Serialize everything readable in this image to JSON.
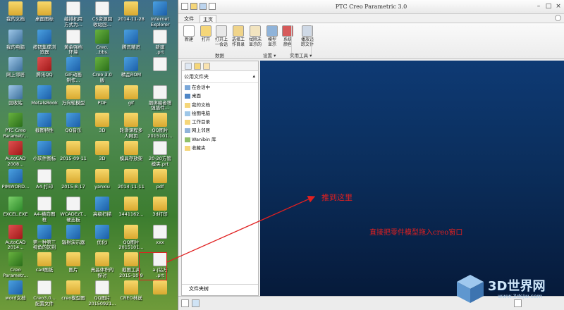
{
  "desktop": {
    "icons": [
      {
        "label": "我的文档",
        "icon": "folder-icon"
      },
      {
        "label": "桌面图标",
        "icon": "folder-icon"
      },
      {
        "label": "编排机用\n方式为...",
        "icon": "document-icon"
      },
      {
        "label": "CS资源回\n收站回...",
        "icon": "document-icon"
      },
      {
        "label": "2014-11-28",
        "icon": "folder-icon"
      },
      {
        "label": "Internet\nExplorer",
        "icon": "ie-icon"
      },
      {
        "label": "我的电脑",
        "icon": "computer-icon"
      },
      {
        "label": "按钮集成浏\n览器",
        "icon": "app-icon"
      },
      {
        "label": "黄金强档\n环境\n2...",
        "icon": "document-icon"
      },
      {
        "label": "Creo.\n..bbs.",
        "icon": "creo-icon"
      },
      {
        "label": "腾讯精灵",
        "icon": "app-icon"
      },
      {
        "label": "新建\n.prt",
        "icon": "document-icon"
      },
      {
        "label": "网上邻居",
        "icon": "network-icon"
      },
      {
        "label": "腾讯QQ",
        "icon": "qq-icon"
      },
      {
        "label": "GIF动画\n制作...",
        "icon": "app-icon"
      },
      {
        "label": "Creo 3.0\n版",
        "icon": "creo-icon"
      },
      {
        "label": "精品ROM",
        "icon": "app-icon"
      },
      {
        "label": "",
        "icon": "document-icon"
      },
      {
        "label": "回收站",
        "icon": "recycle-icon"
      },
      {
        "label": "MetalsBook",
        "icon": "app-icon"
      },
      {
        "label": "万向轮模型",
        "icon": "folder-icon"
      },
      {
        "label": "PDF",
        "icon": "folder-icon"
      },
      {
        "label": "gif",
        "icon": "folder-icon"
      },
      {
        "label": "捆绑编者增\n强插件...",
        "icon": "document-icon"
      },
      {
        "label": "PTC Creo\nParametr...",
        "icon": "creo-icon"
      },
      {
        "label": "截图特性",
        "icon": "app-icon"
      },
      {
        "label": "QQ音乐",
        "icon": "app-icon"
      },
      {
        "label": "3D",
        "icon": "folder-icon"
      },
      {
        "label": "轮滑课程多\n人网页",
        "icon": "folder-icon"
      },
      {
        "label": "QQ图片\n2015101...",
        "icon": "folder-icon"
      },
      {
        "label": "AutoCAD\n2008...",
        "icon": "autocad-icon"
      },
      {
        "label": "小软件图标",
        "icon": "app-icon"
      },
      {
        "label": "2015-09-11",
        "icon": "folder-icon"
      },
      {
        "label": "3D",
        "icon": "folder-icon"
      },
      {
        "label": "模具存放架",
        "icon": "folder-icon"
      },
      {
        "label": "20-20方管\n模夹.prt",
        "icon": "document-icon"
      },
      {
        "label": "PIMWORD...",
        "icon": "app-icon"
      },
      {
        "label": "A4-打印",
        "icon": "document-icon"
      },
      {
        "label": "2015-8-17",
        "icon": "folder-icon"
      },
      {
        "label": "yanxiu",
        "icon": "folder-icon"
      },
      {
        "label": "2014-11-11",
        "icon": "folder-icon"
      },
      {
        "label": "pdf",
        "icon": "folder-icon"
      },
      {
        "label": "EXCEL.EXE",
        "icon": "excel-icon"
      },
      {
        "label": "A4-横向图\n框",
        "icon": "document-icon"
      },
      {
        "label": "WCADEzT...\n硬志板",
        "icon": "document-icon"
      },
      {
        "label": "高级扫描",
        "icon": "app-icon"
      },
      {
        "label": "1441162...",
        "icon": "folder-icon"
      },
      {
        "label": "3d打印",
        "icon": "folder-icon"
      },
      {
        "label": "AutoCAD\n2014...",
        "icon": "autocad-icon"
      },
      {
        "label": "第一种第三\n视角的区别",
        "icon": "app-icon"
      },
      {
        "label": "辐射演示器",
        "icon": "app-icon"
      },
      {
        "label": "优化I",
        "icon": "app-icon"
      },
      {
        "label": "QQ图片\n2015101...",
        "icon": "folder-icon"
      },
      {
        "label": "xxx",
        "icon": "document-icon"
      },
      {
        "label": "Creo\nParametr...",
        "icon": "creo-icon"
      },
      {
        "label": "cad图纸",
        "icon": "folder-icon"
      },
      {
        "label": "图片",
        "icon": "folder-icon"
      },
      {
        "label": "亮晶体积的\n探讨",
        "icon": "folder-icon"
      },
      {
        "label": "截图工具\n2015-10-9",
        "icon": "folder-icon"
      },
      {
        "label": "a-j钻万\n.prt",
        "icon": "document-icon"
      },
      {
        "label": "word文档",
        "icon": "word-icon"
      },
      {
        "label": "Creo3.0...\n配置文件",
        "icon": "document-icon"
      },
      {
        "label": "creo模型图",
        "icon": "folder-icon"
      },
      {
        "label": "QQ图片\n20150921...",
        "icon": "document-icon"
      },
      {
        "label": "CREO林送",
        "icon": "folder-icon"
      },
      {
        "label": "",
        "icon": "folder-icon"
      }
    ]
  },
  "creo": {
    "title": "PTC Creo Parametric 3.0",
    "tabs": [
      "文件",
      "主页"
    ],
    "ribbon": {
      "buttons": [
        {
          "label": "新建",
          "icon": "new-icon"
        },
        {
          "label": "打开",
          "icon": "open-icon"
        },
        {
          "label": "打开上\n一会话",
          "icon": "open-last-session-icon"
        },
        {
          "label": "选择工\n作目录",
          "icon": "select-working-dir-icon"
        },
        {
          "label": "拭除未\n显示的",
          "icon": "erase-not-displayed-icon"
        },
        {
          "label": "模型\n显示",
          "icon": "model-display-icon"
        },
        {
          "label": "系统\n颜色",
          "icon": "system-colors-icon"
        },
        {
          "label": "播放追\n踪文件",
          "icon": "play-trail-file-icon"
        }
      ],
      "groups": [
        "数据",
        "设置 ▾",
        "实用工具 ▾"
      ]
    },
    "navigator": {
      "header": "公用文件夹",
      "items": [
        "在会话中",
        "桌面",
        "我的文档",
        "绘图电脑",
        "工作目录",
        "网上邻居",
        "Wanibin 库",
        "收藏夹"
      ],
      "footer": "文件夹树"
    }
  },
  "annotations": {
    "label1": "推到这里",
    "label2": "直接把零件模型拖入creo窗口"
  },
  "watermark": {
    "brand": "3D世界网",
    "sub": "www.3dsjw.com"
  }
}
